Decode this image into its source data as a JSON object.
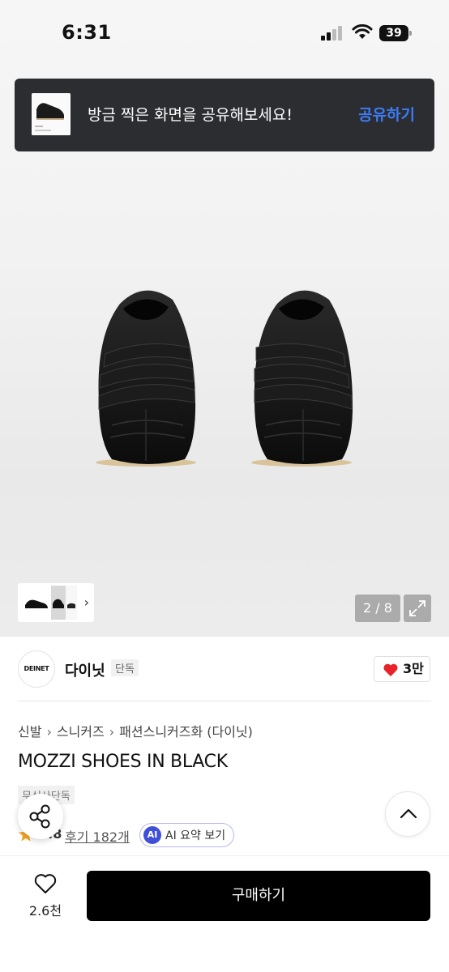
{
  "status_bar": {
    "time": "6:31",
    "battery": "39"
  },
  "share_toast": {
    "message": "방금 찍은 화면을 공유해보세요!",
    "action": "공유하기"
  },
  "gallery": {
    "counter": "2 / 8"
  },
  "brand": {
    "logo_text": "DEINET",
    "name": "다이닛",
    "tag": "단독",
    "likes": "3만"
  },
  "breadcrumb": [
    "신발",
    "스니커즈",
    "패션스니커즈화 (다이닛)"
  ],
  "product": {
    "title": "MOZZI SHOES IN BLACK",
    "badge": "무신사단독",
    "rating": "4.8",
    "reviews": "후기 182개",
    "ai_chip": "AI",
    "ai_summary": "AI 요약 보기"
  },
  "bottom_bar": {
    "wish_count": "2.6천",
    "buy_label": "구매하기"
  },
  "colors": {
    "accent_blue": "#3d7bf6",
    "heart_red": "#e8232a",
    "star_orange": "#f5a623",
    "ai_purple": "#3f4fd8"
  }
}
